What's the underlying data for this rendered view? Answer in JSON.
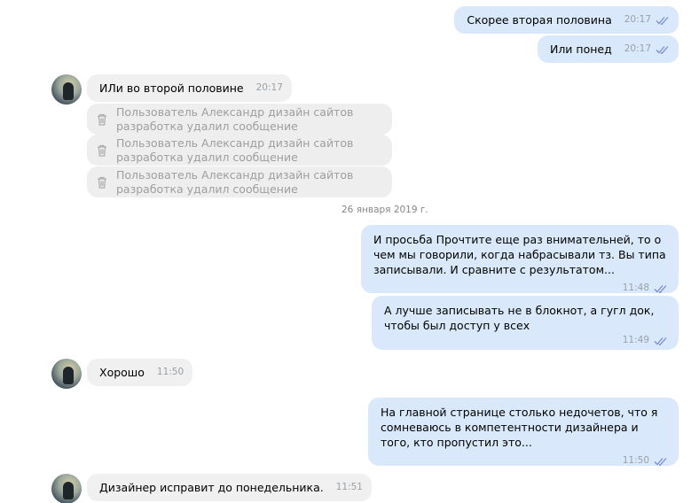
{
  "colors": {
    "outgoing_bubble": "#d9e9fb",
    "incoming_bubble": "#f0f0f0",
    "read_ticks": "#7b8bd8",
    "time_text": "#9aa0a6"
  },
  "icons": {
    "read_status": "double-check-icon",
    "deleted": "trash-icon"
  },
  "messages": [
    {
      "direction": "out",
      "text": "Скорее вторая половина",
      "time": "20:17"
    },
    {
      "direction": "out",
      "text": "Или понед",
      "time": "20:17"
    },
    {
      "direction": "in",
      "text": "ИЛи во второй половине",
      "time": "20:17"
    },
    {
      "direction": "deleted",
      "text": "Пользователь Александр дизайн сайтов разработка удалил сообщение"
    },
    {
      "direction": "deleted",
      "text": "Пользователь Александр дизайн сайтов разработка удалил сообщение"
    },
    {
      "direction": "deleted",
      "text": "Пользователь Александр дизайн сайтов разработка удалил сообщение"
    },
    {
      "direction": "out",
      "text": "И просьба Прочтите еще раз внимательней, то о чем мы говорили, когда набрасывали тз. Вы типа записывали. И сравните с результатом...",
      "time": "11:48"
    },
    {
      "direction": "out",
      "text": "А лучше записывать не в блокнот, а гугл док, чтобы был доступ у всех",
      "time": "11:49"
    },
    {
      "direction": "in",
      "text": "Хорошо",
      "time": "11:50"
    },
    {
      "direction": "out",
      "text": "На главной странице столько недочетов, что я сомневаюсь в компетентности дизайнера и того, кто пропустил это...",
      "time": "11:50"
    },
    {
      "direction": "in",
      "text": "Дизайнер исправит до понедельника.",
      "time": "11:51"
    }
  ],
  "date_separator": "26 января 2019 г."
}
